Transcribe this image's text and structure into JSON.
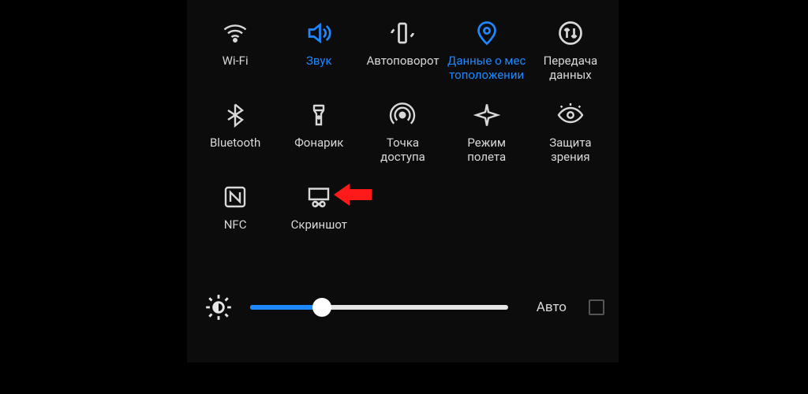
{
  "tiles": [
    {
      "id": "wifi",
      "label": "Wi-Fi",
      "icon": "wifi-icon",
      "active": false
    },
    {
      "id": "sound",
      "label": "Звук",
      "icon": "sound-icon",
      "active": true
    },
    {
      "id": "rotate",
      "label": "Автоповорот",
      "icon": "rotate-icon",
      "active": false
    },
    {
      "id": "location",
      "label": "Данные о мес тоположении",
      "icon": "location-icon",
      "active": true
    },
    {
      "id": "data",
      "label": "Передача данных",
      "icon": "data-icon",
      "active": false
    },
    {
      "id": "bluetooth",
      "label": "Bluetooth",
      "icon": "bluetooth-icon",
      "active": false
    },
    {
      "id": "flashlight",
      "label": "Фонарик",
      "icon": "flashlight-icon",
      "active": false
    },
    {
      "id": "hotspot",
      "label": "Точка доступа",
      "icon": "hotspot-icon",
      "active": false
    },
    {
      "id": "airplane",
      "label": "Режим полета",
      "icon": "airplane-icon",
      "active": false
    },
    {
      "id": "eyecare",
      "label": "Защита зрения",
      "icon": "eye-icon",
      "active": false
    },
    {
      "id": "nfc",
      "label": "NFC",
      "icon": "nfc-icon",
      "active": false
    },
    {
      "id": "screenshot",
      "label": "Скриншот",
      "icon": "screenshot-icon",
      "active": false
    }
  ],
  "brightness": {
    "percent": 28,
    "auto_label": "Авто",
    "auto_checked": false
  },
  "pointer": {
    "target_tile": "screenshot",
    "color": "#ff1a1a"
  },
  "colors": {
    "accent": "#1e88ff",
    "fg": "#d8d8d8",
    "bg": "#0c0c0d"
  }
}
